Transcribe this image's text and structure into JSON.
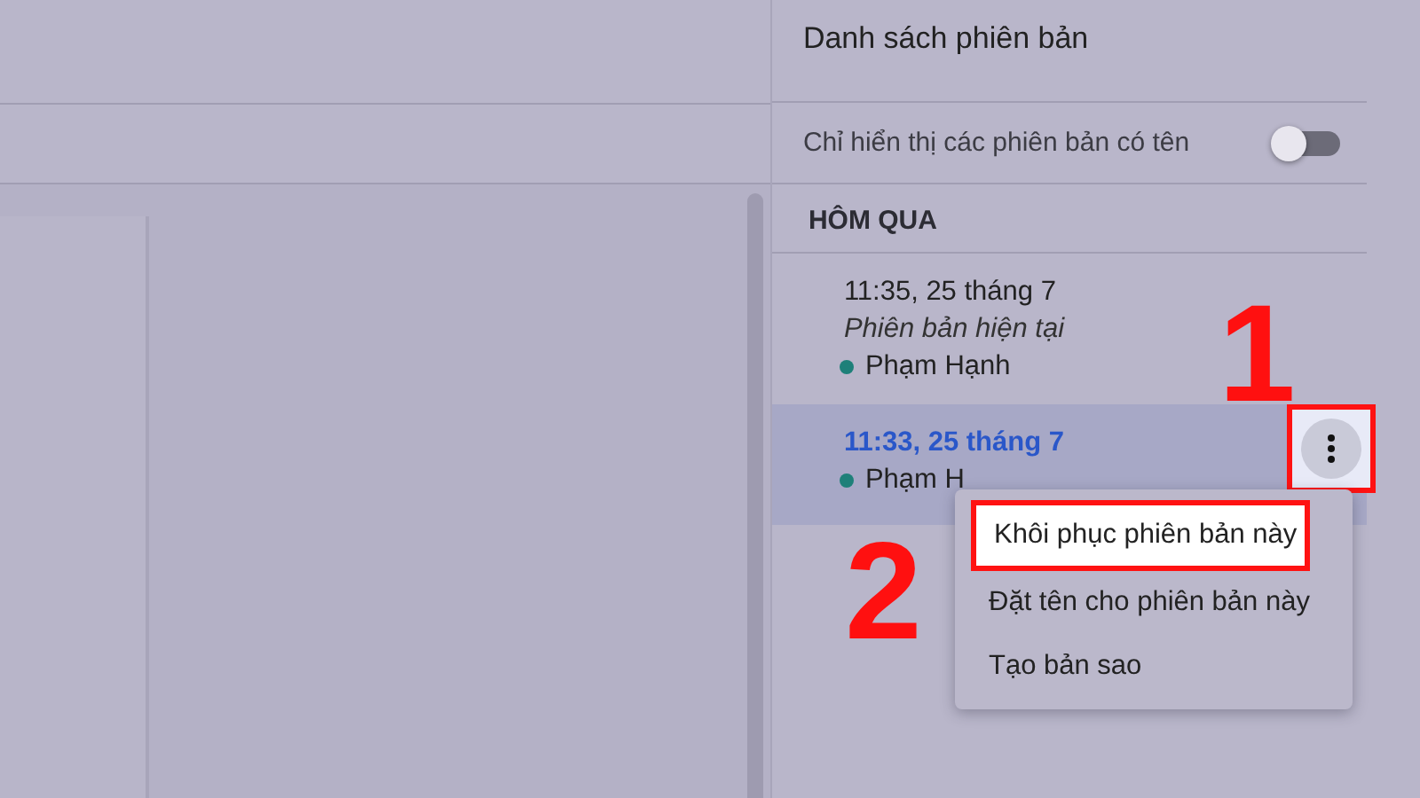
{
  "panel": {
    "title": "Danh sách phiên bản",
    "toggle": {
      "label": "Chỉ hiển thị các phiên bản có tên",
      "on": false
    },
    "section": "HÔM QUA",
    "versions": [
      {
        "time": "11:35, 25 tháng 7",
        "note": "Phiên bản hiện tại",
        "author": "Phạm Hạnh",
        "color": "#1e8079",
        "selected": false,
        "step": "1"
      },
      {
        "time": "11:33, 25 tháng 7",
        "author": "Phạm H",
        "color": "#1e8079",
        "selected": true,
        "more_button": true
      }
    ]
  },
  "menu": {
    "items": [
      {
        "label": "Khôi phục phiên bản này",
        "highlighted": true
      },
      {
        "label": "Đặt tên cho phiên bản này",
        "highlighted": false
      },
      {
        "label": "Tạo bản sao",
        "highlighted": false
      }
    ]
  },
  "annotations": [
    {
      "kind": "step",
      "text": "2"
    }
  ]
}
